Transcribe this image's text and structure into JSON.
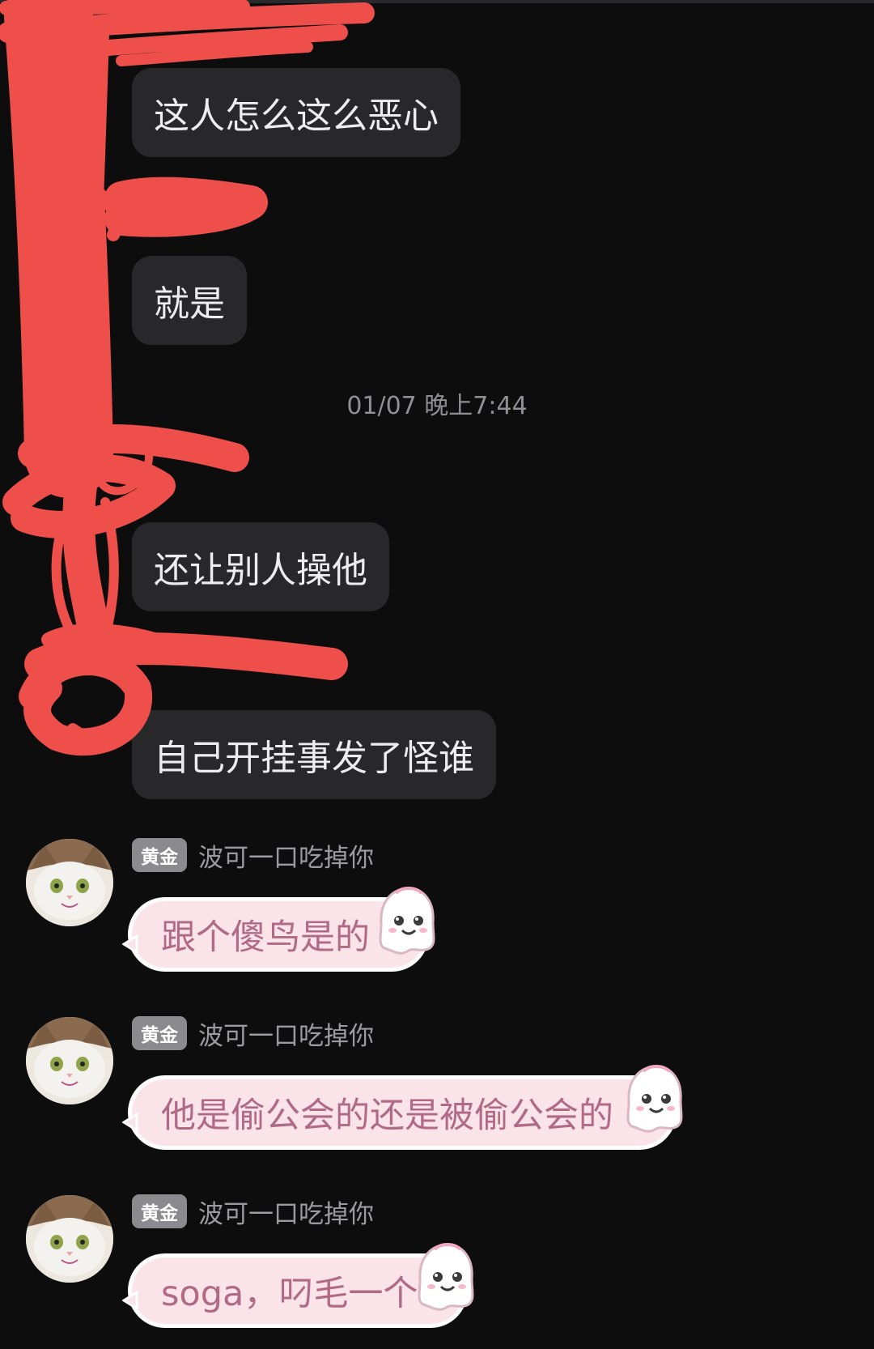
{
  "messages_incoming": [
    {
      "text": "这人怎么这么恶心"
    },
    {
      "text": "就是"
    },
    {
      "text": "还让别人操他"
    },
    {
      "text": "自己开挂事发了怪谁"
    }
  ],
  "timestamp": "01/07 晚上7:44",
  "group_messages": [
    {
      "badge": "黄金",
      "username": "波可一口吃掉你",
      "text": "跟个傻鸟是的"
    },
    {
      "badge": "黄金",
      "username": "波可一口吃掉你",
      "text": "他是偷公会的还是被偷公会的"
    },
    {
      "badge": "黄金",
      "username": "波可一口吃掉你",
      "text": "soga，叼毛一个"
    }
  ],
  "colors": {
    "background": "#0d0d0e",
    "bubble_dark": "#28282b",
    "bubble_pink": "#fbe3ea",
    "pink_text": "#b06a86",
    "scribble_red": "#ef4f4a",
    "badge_gray": "#8b8b8f"
  },
  "icons": [
    "cat-avatar",
    "ghost-sticker-icon"
  ]
}
